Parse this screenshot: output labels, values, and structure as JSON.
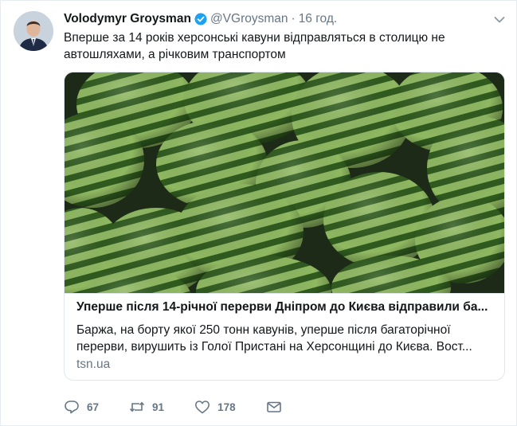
{
  "tweet": {
    "author_name": "Volodymyr Groysman",
    "handle": "@VGroysman",
    "separator": "·",
    "time": "16 год.",
    "text": "Вперше за 14 років херсонські кавуни відправляться в столицю не автошляхами, а річковим транспортом"
  },
  "card": {
    "title": "Уперше після 14-річної перерви Дніпром до Києва відправили ба...",
    "description": "Баржа, на борту якої 250 тонн кавунів, уперше після багаторічної перерви, вирушить із Голої Пристані на Херсонщині до Києва. Вост...",
    "domain": "tsn.ua"
  },
  "actions": {
    "replies": "67",
    "retweets": "91",
    "likes": "178"
  },
  "colors": {
    "text": "#14171a",
    "secondary": "#657786",
    "verified": "#1da1f2",
    "border": "#e1e8ed"
  },
  "icons": [
    "verified-badge-icon",
    "chevron-down-icon",
    "reply-icon",
    "retweet-icon",
    "like-icon",
    "direct-message-icon"
  ]
}
